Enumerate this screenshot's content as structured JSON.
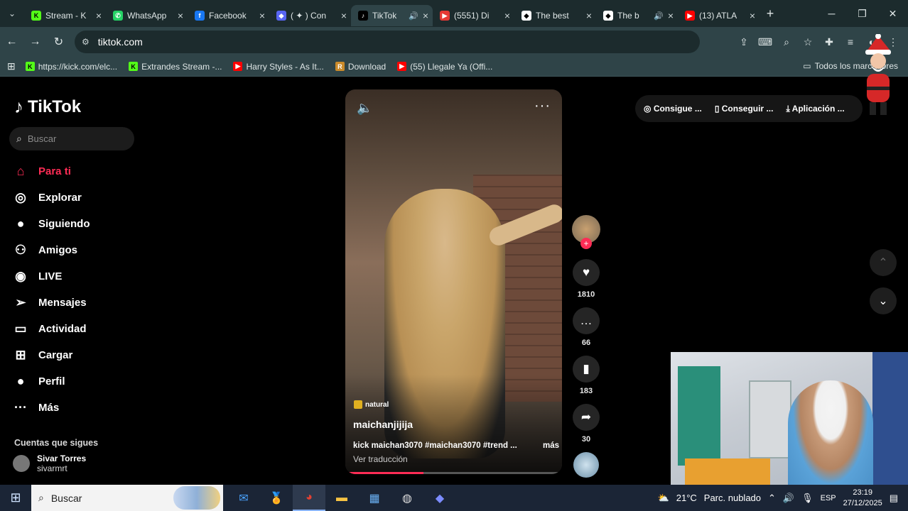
{
  "browser": {
    "tabs": [
      {
        "title": "Stream - K",
        "fav": "K",
        "favcolor": "#53fc18",
        "favtext": "#000"
      },
      {
        "title": "WhatsApp",
        "fav": "✆",
        "favcolor": "#25d366",
        "favtext": "#fff"
      },
      {
        "title": "Facebook",
        "fav": "f",
        "favcolor": "#1877f2",
        "favtext": "#fff"
      },
      {
        "title": "( ✦ ) Con",
        "fav": "◆",
        "favcolor": "#5865f2",
        "favtext": "#fff"
      },
      {
        "title": "TikTok",
        "fav": "♪",
        "favcolor": "#000",
        "favtext": "#fff",
        "active": true,
        "sound": true
      },
      {
        "title": "(5551) Di",
        "fav": "▶",
        "favcolor": "#e53935",
        "favtext": "#fff"
      },
      {
        "title": "The best",
        "fav": "◆",
        "favcolor": "#ffffff",
        "favtext": "#000"
      },
      {
        "title": "The b",
        "fav": "◆",
        "favcolor": "#ffffff",
        "favtext": "#000",
        "sound": true
      },
      {
        "title": "(13) ATLA",
        "fav": "▶",
        "favcolor": "#ff0000",
        "favtext": "#fff"
      }
    ],
    "url": "tiktok.com",
    "bookmarks": [
      {
        "label": "https://kick.com/elc...",
        "icon": "K",
        "color": "#53fc18",
        "text": "#000"
      },
      {
        "label": "Extrandes Stream -...",
        "icon": "K",
        "color": "#53fc18",
        "text": "#000"
      },
      {
        "label": "Harry Styles - As It...",
        "icon": "▶",
        "color": "#ff0000",
        "text": "#fff"
      },
      {
        "label": "Download",
        "icon": "R",
        "color": "#c98a2a",
        "text": "#fff"
      },
      {
        "label": "(55) Llegale Ya (Offi...",
        "icon": "▶",
        "color": "#ff0000",
        "text": "#fff"
      }
    ],
    "bookmarks_all": "Todos los marcadores"
  },
  "sidebar": {
    "brand": "TikTok",
    "search_placeholder": "Buscar",
    "items": [
      {
        "label": "Para ti",
        "icon": "⌂"
      },
      {
        "label": "Explorar",
        "icon": "◎"
      },
      {
        "label": "Siguiendo",
        "icon": "●"
      },
      {
        "label": "Amigos",
        "icon": "⚇"
      },
      {
        "label": "LIVE",
        "icon": "◉"
      },
      {
        "label": "Mensajes",
        "icon": "➢"
      },
      {
        "label": "Actividad",
        "icon": "▭"
      },
      {
        "label": "Cargar",
        "icon": "⊞"
      },
      {
        "label": "Perfil",
        "icon": "●"
      },
      {
        "label": "Más",
        "icon": "···"
      }
    ],
    "following_title": "Cuentas que sigues",
    "accounts": [
      {
        "name": "Sivar Torres",
        "handle": "sivarmrt"
      }
    ]
  },
  "video": {
    "tag": "natural",
    "username": "maichanjijija",
    "description": "kick maichan3070 #maichan3070 #trend ...",
    "more": "más",
    "translate": "Ver traducción",
    "progress": 0.36
  },
  "actions": {
    "likes": "1810",
    "comments": "66",
    "saves": "183",
    "shares": "30"
  },
  "getapp": {
    "b1": "Consigue ...",
    "b2": "Conseguir ...",
    "b3": "Aplicación ..."
  },
  "taskbar": {
    "search": "Buscar",
    "temp": "21°C",
    "weather": "Parc. nublado",
    "lang": "ESP",
    "time": "23:19",
    "date": "27/12/2025"
  },
  "colors": {
    "accent": "#fe2c55",
    "browser_dark": "#1c2b2d",
    "browser_mid": "#2f4448"
  }
}
